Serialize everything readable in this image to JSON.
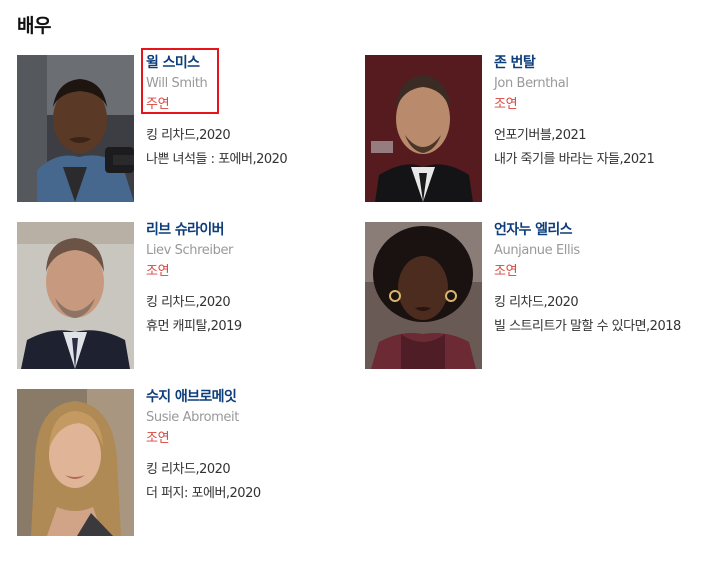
{
  "section": {
    "title": "배우"
  },
  "actors": [
    {
      "name_ko": "윌 스미스",
      "name_en": "Will Smith",
      "role": "주연",
      "works": [
        "킹 리차드,2020",
        "나쁜 녀석들 : 포에버,2020"
      ]
    },
    {
      "name_ko": "존 번탈",
      "name_en": "Jon Bernthal",
      "role": "조연",
      "works": [
        "언포기버블,2021",
        "내가 죽기를 바라는 자들,2021"
      ]
    },
    {
      "name_ko": "리브 슈라이버",
      "name_en": "Liev Schreiber",
      "role": "조연",
      "works": [
        "킹 리차드,2020",
        "휴먼 캐피탈,2019"
      ]
    },
    {
      "name_ko": "언자누 엘리스",
      "name_en": "Aunjanue Ellis",
      "role": "조연",
      "works": [
        "킹 리차드,2020",
        "빌 스트리트가 말할 수 있다면,2018"
      ]
    },
    {
      "name_ko": "수지 애브로메잇",
      "name_en": "Susie Abromeit",
      "role": "조연",
      "works": [
        "킹 리차드,2020",
        "더 퍼지: 포에버,2020"
      ]
    }
  ]
}
